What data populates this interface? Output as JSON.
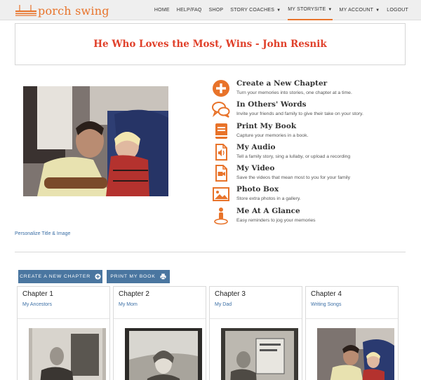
{
  "nav": {
    "logo_text": "porch swing",
    "items": [
      {
        "label": "HOME",
        "dropdown": false,
        "active": false
      },
      {
        "label": "HELP/FAQ",
        "dropdown": false,
        "active": false
      },
      {
        "label": "SHOP",
        "dropdown": false,
        "active": false
      },
      {
        "label": "STORY COACHES",
        "dropdown": true,
        "active": false
      },
      {
        "label": "MY STORYSITE",
        "dropdown": true,
        "active": true
      },
      {
        "label": "MY ACCOUNT",
        "dropdown": true,
        "active": false
      },
      {
        "label": "LOGOUT",
        "dropdown": false,
        "active": false
      }
    ]
  },
  "page": {
    "title": "He Who Loves the Most, Wins - John Resnik",
    "personalize_link": "Personalize Title & Image"
  },
  "features": [
    {
      "title": "Create a New Chapter",
      "desc": "Turn your memories into stories, one chapter at a time.",
      "icon": "plus-circle-icon"
    },
    {
      "title": "In Others' Words",
      "desc": "Invite your friends and family to give their take on your story.",
      "icon": "chat-bubbles-icon"
    },
    {
      "title": "Print My Book",
      "desc": "Capture your memories in a book.",
      "icon": "book-icon"
    },
    {
      "title": "My Audio",
      "desc": "Tell a family story, sing a lullaby, or upload a recording",
      "icon": "audio-file-icon"
    },
    {
      "title": "My Video",
      "desc": "Save the videos that mean most to you for your family",
      "icon": "video-file-icon"
    },
    {
      "title": "Photo Box",
      "desc": "Store extra photos in a gallery.",
      "icon": "photo-icon"
    },
    {
      "title": "Me At A Glance",
      "desc": "Easy reminders to jog your memories",
      "icon": "person-pin-icon"
    }
  ],
  "buttons": {
    "create_chapter": "CREATE A NEW CHAPTER",
    "print_book": "PRINT MY BOOK"
  },
  "chapters": [
    {
      "title": "Chapter 1",
      "subtitle": "My Ancestors"
    },
    {
      "title": "Chapter 2",
      "subtitle": "My Mom"
    },
    {
      "title": "Chapter 3",
      "subtitle": "My Dad"
    },
    {
      "title": "Chapter 4",
      "subtitle": "Writing Songs"
    }
  ],
  "colors": {
    "accent": "#e8732a",
    "title_red": "#e0402a",
    "button_blue": "#4a76a0",
    "link_blue": "#3a6ea5"
  }
}
